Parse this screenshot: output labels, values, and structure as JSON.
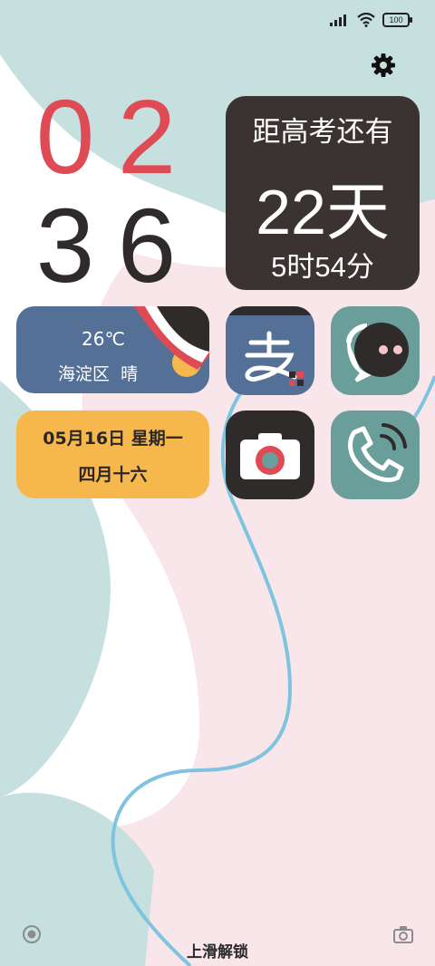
{
  "status_bar": {
    "battery_level": "100",
    "signal_icon": "signal-icon",
    "wifi_icon": "wifi-icon"
  },
  "clock": {
    "hour_tens": "0",
    "hour_ones": "2",
    "minute_tens": "3",
    "minute_ones": "6"
  },
  "countdown": {
    "title": "距高考还有",
    "days": "22天",
    "time_left": "5时54分"
  },
  "weather": {
    "temperature": "26℃",
    "location": "海淀区  晴"
  },
  "date": {
    "line1": "05月16日 星期一",
    "lunar": "四月十六"
  },
  "apps": [
    "alipay-icon",
    "messages-icon",
    "camera-icon",
    "phone-icon"
  ],
  "bottom": {
    "unlock_text": "上滑解锁"
  },
  "colors": {
    "red": "#df4b55",
    "dark": "#2f2b2a",
    "teal": "#6a9e9b",
    "navy": "#557096",
    "yellow": "#f6b84c",
    "mint": "#c6e0e0",
    "pink": "#f9e6ea",
    "line": "#7ec4df"
  }
}
